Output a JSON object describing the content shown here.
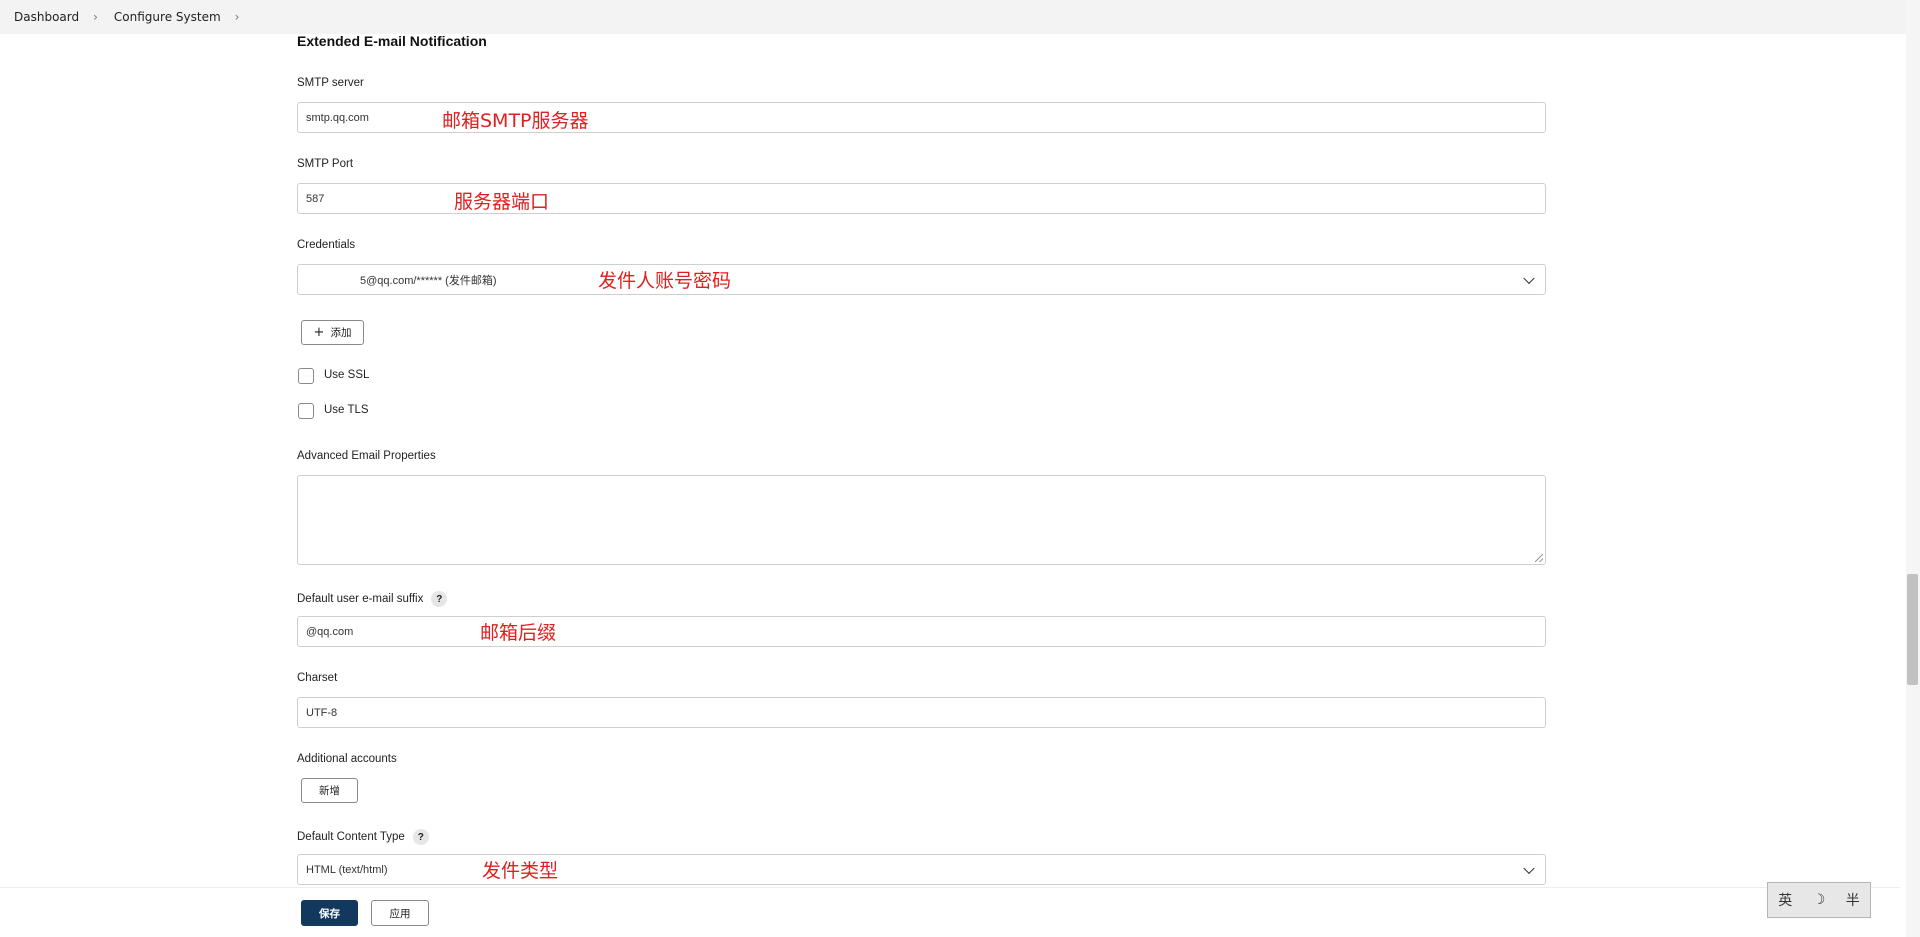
{
  "breadcrumb": {
    "items": [
      "Dashboard",
      "Configure System"
    ]
  },
  "section": {
    "title": "Extended E-mail Notification"
  },
  "smtp_server": {
    "label": "SMTP server",
    "value": "smtp.qq.com",
    "annotation": "邮箱SMTP服务器"
  },
  "smtp_port": {
    "label": "SMTP Port",
    "value": "587",
    "annotation": "服务器端口"
  },
  "credentials": {
    "label": "Credentials",
    "value": "5@qq.com/****** (发件邮箱)",
    "annotation": "发件人账号密码",
    "add_button": "添加"
  },
  "checkboxes": {
    "use_ssl": "Use SSL",
    "use_tls": "Use TLS"
  },
  "advanced_email_properties": {
    "label": "Advanced Email Properties",
    "value": ""
  },
  "default_suffix": {
    "label": "Default user e-mail suffix",
    "value": "@qq.com",
    "annotation": "邮箱后缀"
  },
  "charset": {
    "label": "Charset",
    "value": "UTF-8"
  },
  "additional_accounts": {
    "label": "Additional accounts",
    "add_button": "新增"
  },
  "default_content_type": {
    "label": "Default Content Type",
    "value": "HTML (text/html)",
    "annotation": "发件类型"
  },
  "footer": {
    "save": "保存",
    "apply": "应用"
  },
  "help_glyph": "?",
  "ime": {
    "lang": "英",
    "moon": "☽",
    "width": "半"
  },
  "colors": {
    "primary_button": "#12395d",
    "annotation_red": "#e02020"
  }
}
